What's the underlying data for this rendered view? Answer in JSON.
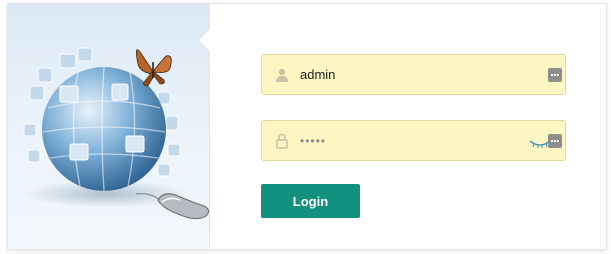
{
  "login_form": {
    "username_value": "admin",
    "password_mask": "•••••",
    "login_label": "Login"
  },
  "icons": {
    "username": "user-icon",
    "password": "lock-icon",
    "keyboard": "keyboard-icon",
    "illustration": "puzzle-globe-illustration"
  },
  "colors": {
    "field_background": "#fdf6c3",
    "button": "#12917f"
  }
}
